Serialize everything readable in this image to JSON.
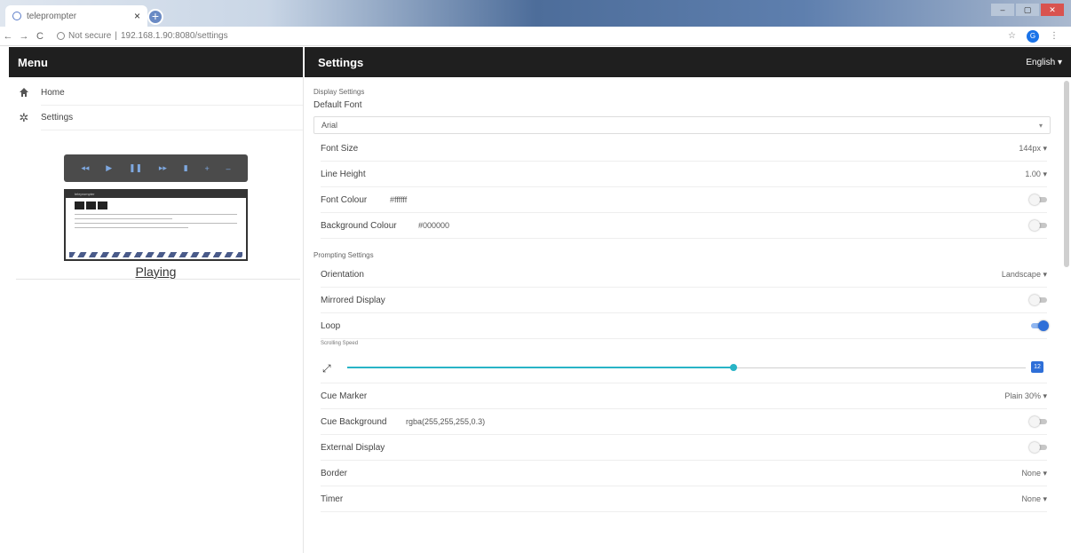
{
  "browser": {
    "tab_title": "teleprompter",
    "tab_close": "×",
    "new_tab": "+",
    "nav_back": "←",
    "nav_forward": "→",
    "nav_reload": "C",
    "security_label": "Not secure",
    "url": "192.168.1.90:8080/settings",
    "star": "☆",
    "profile_letter": "G",
    "menu_dots": "⋮",
    "win_min": "–",
    "win_max": "▢",
    "win_close": "✕"
  },
  "menu": {
    "title": "Menu",
    "items": [
      {
        "label": "Home",
        "icon": "home-icon"
      },
      {
        "label": "Settings",
        "icon": "gear-icon"
      }
    ],
    "preview_status": "Playing",
    "player_controls": [
      "◂◂",
      "▶",
      "❚❚",
      "▸▸",
      "▮",
      "+",
      "–"
    ],
    "thumbnail_title": "teleprompter"
  },
  "settings": {
    "title": "Settings",
    "language": "English",
    "display_section": "Display Settings",
    "default_font_label": "Default Font",
    "default_font_value": "Arial",
    "font_size": {
      "label": "Font Size",
      "value": "144px"
    },
    "line_height": {
      "label": "Line Height",
      "value": "1.00"
    },
    "font_colour": {
      "label": "Font Colour",
      "value": "#ffffff",
      "enabled": false
    },
    "background_colour": {
      "label": "Background Colour",
      "value": "#000000",
      "enabled": false
    },
    "prompting_section": "Prompting Settings",
    "orientation": {
      "label": "Orientation",
      "value": "Landscape"
    },
    "mirrored_display": {
      "label": "Mirrored Display",
      "enabled": false
    },
    "loop": {
      "label": "Loop",
      "enabled": true
    },
    "scrolling_speed": {
      "label": "Scrolling Speed",
      "value": "12",
      "fraction": 0.57
    },
    "cue_marker": {
      "label": "Cue Marker",
      "value": "Plain 30%"
    },
    "cue_background": {
      "label": "Cue Background",
      "value": "rgba(255,255,255,0.3)",
      "enabled": false
    },
    "external_display": {
      "label": "External Display",
      "enabled": false
    },
    "border": {
      "label": "Border",
      "value": "None"
    },
    "timer": {
      "label": "Timer",
      "value": "None"
    },
    "caret": "▾"
  },
  "colors": {
    "header_bg": "#1f1f1f",
    "accent": "#2e6fd8",
    "slider": "#28b4c6"
  }
}
